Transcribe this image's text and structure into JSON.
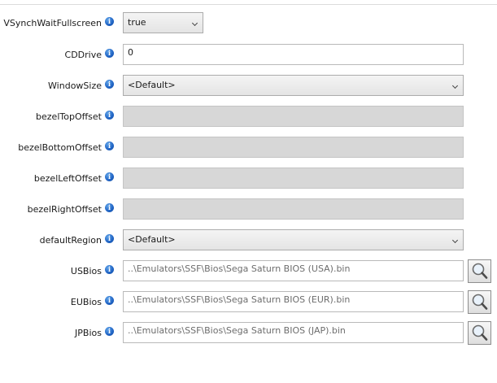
{
  "rows": [
    {
      "label": "VSynchWaitFullscreen",
      "type": "select",
      "value": "true"
    },
    {
      "label": "CDDrive",
      "type": "text",
      "value": "0"
    },
    {
      "label": "WindowSize",
      "type": "select",
      "value": "<Default>"
    },
    {
      "label": "bezelTopOffset",
      "type": "disabled",
      "value": ""
    },
    {
      "label": "bezelBottomOffset",
      "type": "disabled",
      "value": ""
    },
    {
      "label": "bezelLeftOffset",
      "type": "disabled",
      "value": ""
    },
    {
      "label": "bezelRightOffset",
      "type": "disabled",
      "value": ""
    },
    {
      "label": "defaultRegion",
      "type": "select",
      "value": "<Default>"
    },
    {
      "label": "USBios",
      "type": "path",
      "value": "..\\Emulators\\SSF\\Bios\\Sega Saturn BIOS (USA).bin"
    },
    {
      "label": "EUBios",
      "type": "path",
      "value": "..\\Emulators\\SSF\\Bios\\Sega Saturn BIOS (EUR).bin"
    },
    {
      "label": "JPBios",
      "type": "path",
      "value": "..\\Emulators\\SSF\\Bios\\Sega Saturn BIOS (JAP).bin"
    }
  ],
  "info_glyph": "i",
  "icons": {
    "info": "info-icon",
    "dropdown": "chevron-down-icon",
    "browse": "magnifier-icon"
  },
  "colors": {
    "info_blue": "#1f63c4",
    "disabled_fill": "#d7d7d7",
    "path_text": "#6d6d6d"
  }
}
